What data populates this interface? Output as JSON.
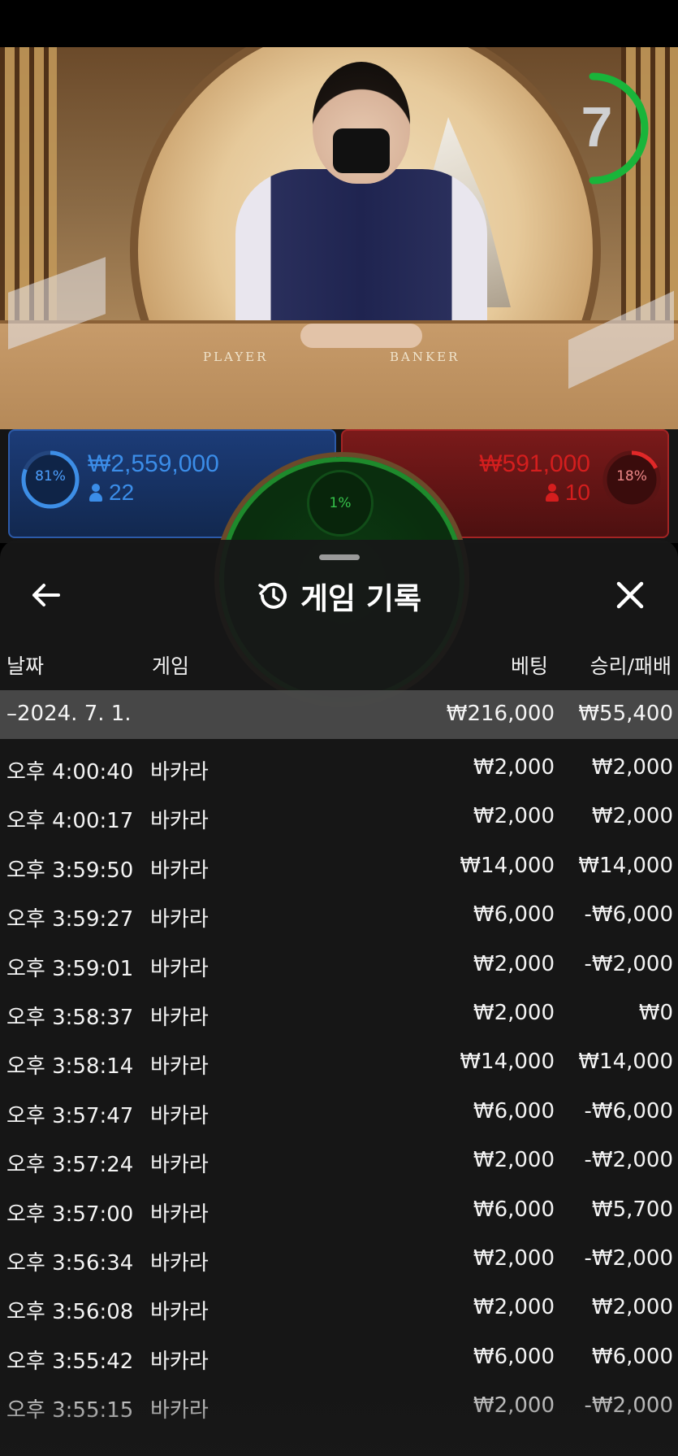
{
  "timer": {
    "value": "7"
  },
  "scene": {
    "table_player": "PLAYER",
    "table_banker": "BANKER"
  },
  "player_panel": {
    "percent": "81%",
    "amount": "₩2,559,000",
    "users": "22"
  },
  "banker_panel": {
    "percent": "18%",
    "amount": "₩591,000",
    "users": "10"
  },
  "tie_panel": {
    "percent": "1%"
  },
  "colors": {
    "player": "#2c5aa8",
    "banker": "#a32424",
    "tie": "#1e8a2c",
    "timer": "#19b53a"
  },
  "sheet": {
    "title": "게임 기록",
    "icons": {
      "back": "arrow-left-icon",
      "title": "history-icon",
      "close": "close-icon"
    },
    "columns": {
      "date": "날짜",
      "game": "게임",
      "bet": "베팅",
      "result": "승리/패배"
    },
    "date_group": {
      "label": "–2024. 7. 1.",
      "bet_total": "₩216,000",
      "result_total": "₩55,400"
    },
    "rows": [
      {
        "time": "오후 4:00:40",
        "game": "바카라",
        "bet": "₩2,000",
        "result": "₩2,000"
      },
      {
        "time": "오후 4:00:17",
        "game": "바카라",
        "bet": "₩2,000",
        "result": "₩2,000"
      },
      {
        "time": "오후 3:59:50",
        "game": "바카라",
        "bet": "₩14,000",
        "result": "₩14,000"
      },
      {
        "time": "오후 3:59:27",
        "game": "바카라",
        "bet": "₩6,000",
        "result": "-₩6,000"
      },
      {
        "time": "오후 3:59:01",
        "game": "바카라",
        "bet": "₩2,000",
        "result": "-₩2,000"
      },
      {
        "time": "오후 3:58:37",
        "game": "바카라",
        "bet": "₩2,000",
        "result": "₩0"
      },
      {
        "time": "오후 3:58:14",
        "game": "바카라",
        "bet": "₩14,000",
        "result": "₩14,000"
      },
      {
        "time": "오후 3:57:47",
        "game": "바카라",
        "bet": "₩6,000",
        "result": "-₩6,000"
      },
      {
        "time": "오후 3:57:24",
        "game": "바카라",
        "bet": "₩2,000",
        "result": "-₩2,000"
      },
      {
        "time": "오후 3:57:00",
        "game": "바카라",
        "bet": "₩6,000",
        "result": "₩5,700"
      },
      {
        "time": "오후 3:56:34",
        "game": "바카라",
        "bet": "₩2,000",
        "result": "-₩2,000"
      },
      {
        "time": "오후 3:56:08",
        "game": "바카라",
        "bet": "₩2,000",
        "result": "₩2,000"
      },
      {
        "time": "오후 3:55:42",
        "game": "바카라",
        "bet": "₩6,000",
        "result": "₩6,000"
      },
      {
        "time": "오후 3:55:15",
        "game": "바카라",
        "bet": "₩2,000",
        "result": "-₩2,000"
      }
    ]
  }
}
